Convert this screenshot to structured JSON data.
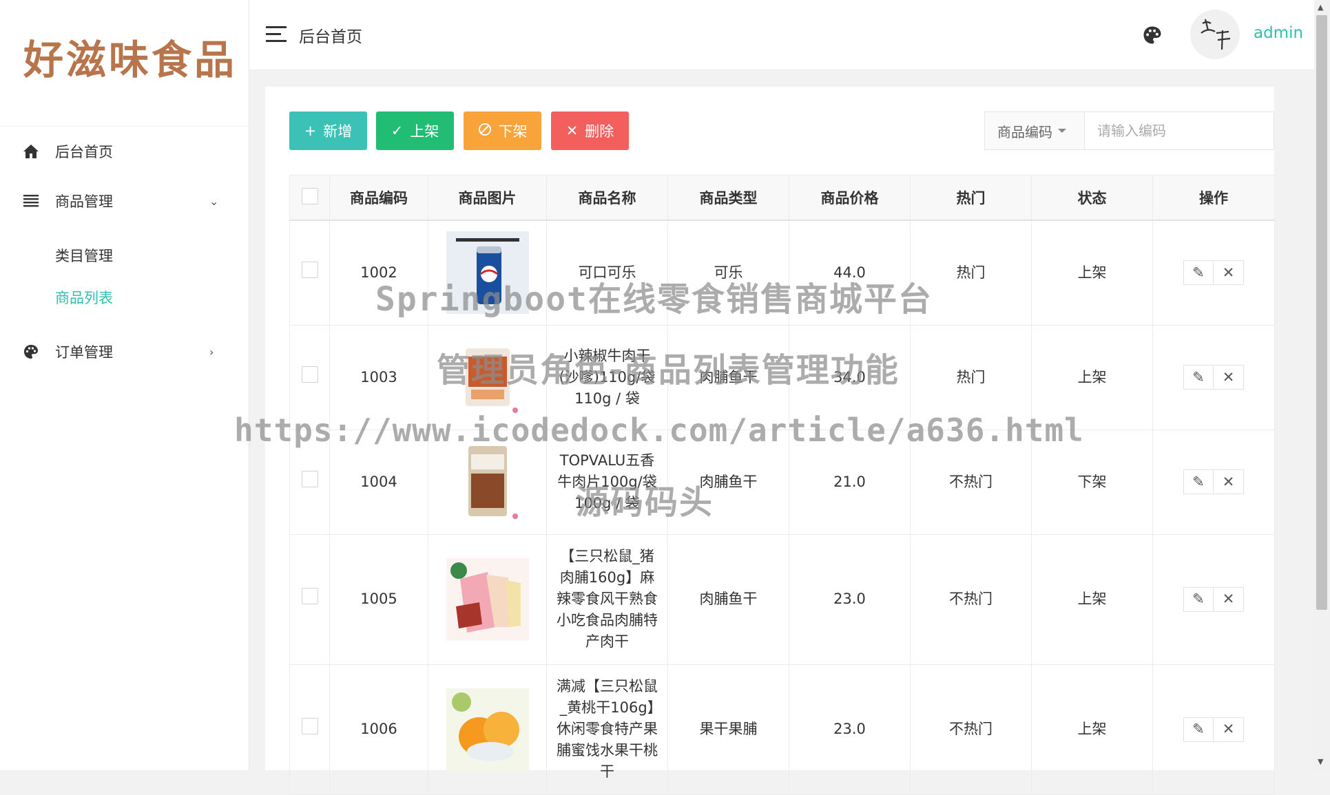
{
  "sidebar": {
    "logo": "好滋味食品",
    "items": [
      {
        "label": "后台首页",
        "icon": "home-icon"
      },
      {
        "label": "商品管理",
        "icon": "list-icon",
        "arrow": "⌄"
      },
      {
        "label": "订单管理",
        "icon": "palette-icon",
        "arrow": "›"
      }
    ],
    "sub_items": [
      {
        "label": "类目管理",
        "active": false
      },
      {
        "label": "商品列表",
        "active": true
      }
    ]
  },
  "header": {
    "title": "后台首页",
    "username": "admin"
  },
  "toolbar": {
    "add_label": "新增",
    "up_label": "上架",
    "down_label": "下架",
    "delete_label": "删除",
    "search_field": "商品编码",
    "search_placeholder": "请输入编码"
  },
  "table": {
    "headers": [
      "商品编码",
      "商品图片",
      "商品名称",
      "商品类型",
      "商品价格",
      "热门",
      "状态",
      "操作"
    ],
    "rows": [
      {
        "code": "1002",
        "name": "可口可乐",
        "type": "可乐",
        "price": "44.0",
        "hot": "热门",
        "status": "上架",
        "img": "cola"
      },
      {
        "code": "1003",
        "name": "小辣椒牛肉干(沙嗲)110g/袋 110g / 袋",
        "type": "肉脯鱼干",
        "price": "34.0",
        "hot": "热门",
        "status": "上架",
        "img": "beef"
      },
      {
        "code": "1004",
        "name": "TOPVALU五香牛肉片100g/袋 100g / 袋",
        "type": "肉脯鱼干",
        "price": "21.0",
        "hot": "不热门",
        "status": "下架",
        "img": "beef2"
      },
      {
        "code": "1005",
        "name": "【三只松鼠_猪肉脯160g】麻辣零食风干熟食小吃食品肉脯特产肉干",
        "type": "肉脯鱼干",
        "price": "23.0",
        "hot": "不热门",
        "status": "上架",
        "img": "pork"
      },
      {
        "code": "1006",
        "name": "满减【三只松鼠_黄桃干106g】休闲零食特产果脯蜜饯水果干桃干",
        "type": "果干果脯",
        "price": "23.0",
        "hot": "不热门",
        "status": "上架",
        "img": "peach"
      }
    ]
  },
  "watermark": {
    "line1": "Springboot在线零食销售商城平台",
    "line2": "管理员角色-商品列表管理功能",
    "line3": "https://www.icodedock.com/article/a636.html",
    "line4": "源码码头"
  },
  "colors": {
    "accent": "#2ebfae",
    "add": "#3bc1b5",
    "up": "#22bd75",
    "down": "#f8a43b",
    "delete": "#f25f5c"
  }
}
